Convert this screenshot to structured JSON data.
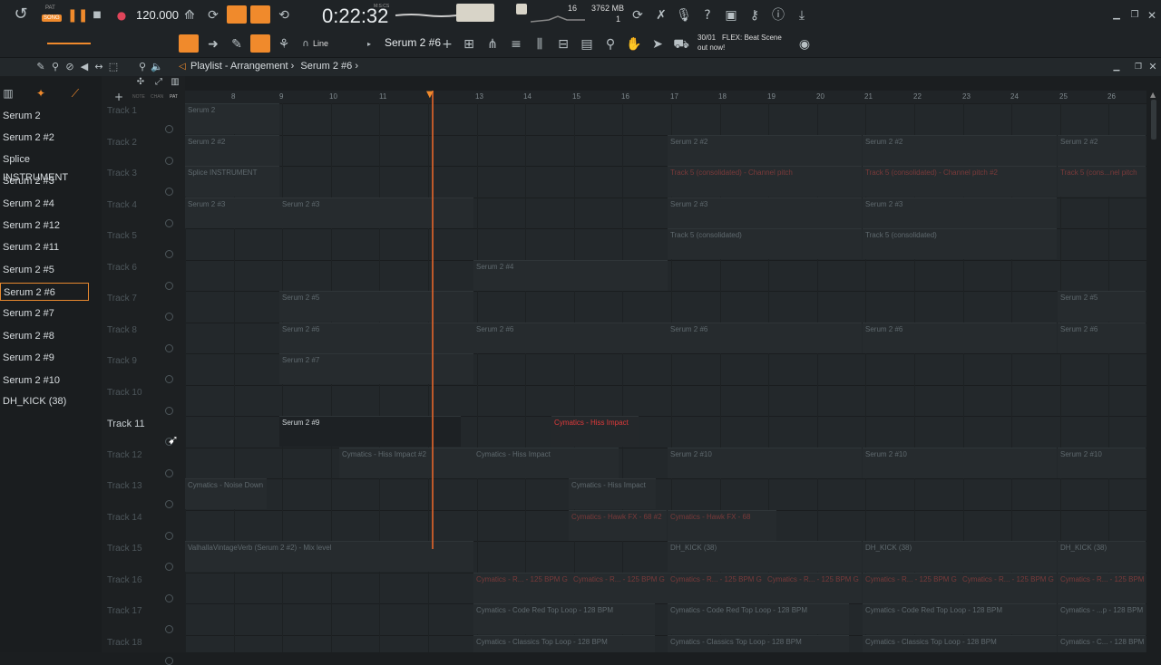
{
  "toolbar": {
    "song_label": "SONG",
    "tempo": "120.000",
    "time": "0:22:32",
    "time_sub": "M:S:CS",
    "cpu_number": "16",
    "memory": "3762 MB",
    "memory_sub": "1",
    "snap_mode": "Line",
    "pattern_name": "Serum 2 #6",
    "news_date": "30/01",
    "news_text_1": "FLEX: Beat Scene",
    "news_text_2": "out now!"
  },
  "playlist": {
    "breadcrumb_1": "Playlist",
    "breadcrumb_sep": " - ",
    "breadcrumb_2": "Arrangement",
    "breadcrumb_3": "Serum 2 #6",
    "header_labels": [
      "NOTE",
      "CHAN",
      "PAT"
    ]
  },
  "ruler": [
    "8",
    "9",
    "10",
    "11",
    "13",
    "14",
    "15",
    "16",
    "17",
    "18",
    "19",
    "20",
    "21",
    "22",
    "23",
    "24",
    "25",
    "26"
  ],
  "channels": [
    {
      "label": "Serum 2"
    },
    {
      "label": "Serum 2 #2"
    },
    {
      "label": "Splice INSTRUMENT"
    },
    {
      "label": "Serum 2 #3"
    },
    {
      "label": "Serum 2 #4"
    },
    {
      "label": "Serum 2 #12"
    },
    {
      "label": "Serum 2 #11"
    },
    {
      "label": "Serum 2 #5"
    },
    {
      "label": "Serum 2 #6"
    },
    {
      "label": "Serum 2 #7"
    },
    {
      "label": "Serum 2 #8"
    },
    {
      "label": "Serum 2 #9"
    },
    {
      "label": "Serum 2 #10"
    },
    {
      "label": "DH_KICK (38)"
    }
  ],
  "tracks": [
    "Track 1",
    "Track 2",
    "Track 3",
    "Track 4",
    "Track 5",
    "Track 6",
    "Track 7",
    "Track 8",
    "Track 9",
    "Track 10",
    "Track 11",
    "Track 12",
    "Track 13",
    "Track 14",
    "Track 15",
    "Track 16",
    "Track 17",
    "Track 18"
  ],
  "clips": {
    "c1": "Serum 2",
    "c2a": "Serum 2 #2",
    "c2b": "Serum 2 #2",
    "c2c": "Serum 2 #2",
    "c2d": "Serum 2 #2",
    "c3a": "Splice INSTRUMENT",
    "c3b": "Track 5 (consolidated) - Channel pitch",
    "c3c": "Track 5 (consolidated) - Channel pitch #2",
    "c3d": "Track 5 (cons...nel pitch",
    "c4a": "Serum 2 #3",
    "c4b": "Serum 2 #3",
    "c4c": "Serum 2 #3",
    "c4d": "Serum 2 #3",
    "c5a": "Track 5 (consolidated)",
    "c5b": "Track 5 (consolidated)",
    "c6a": "Serum 2 #4",
    "c7a": "Serum 2 #5",
    "c7b": "Serum 2 #5",
    "c8a": "Serum 2 #6",
    "c8b": "Serum 2 #6",
    "c8c": "Serum 2 #6",
    "c8d": "Serum 2 #6",
    "c8e": "Serum 2 #6",
    "c9a": "Serum 2 #7",
    "c11a": "Serum 2 #9",
    "c11b": "Cymatics - Hiss Impact",
    "c12a": "Cymatics - Hiss Impact #2",
    "c12b": "Cymatics - Hiss Impact",
    "c12c": "Serum 2 #10",
    "c12d": "Serum 2 #10",
    "c12e": "Serum 2 #10",
    "c13a": "Cymatics - Noise Down",
    "c13b": "Cymatics - Hiss Impact",
    "c14a": "Cymatics - Hawk FX - 68 #2",
    "c14b": "Cymatics - Hawk FX - 68",
    "c15a": "ValhallaVintageVerb (Serum 2 #2) - Mix level",
    "c15b": "DH_KICK (38)",
    "c15c": "DH_KICK (38)",
    "c15d": "DH_KICK (38)",
    "c16a": "Cymatics - R... - 125 BPM G",
    "c16b": "Cymatics - R... - 125 BPM G",
    "c16c": "Cymatics - R... - 125 BPM G",
    "c16d": "Cymatics - R... - 125 BPM G",
    "c16e": "Cymatics - R... - 125 BPM G",
    "c16f": "Cymatics - R... - 125 BPM G",
    "c16g": "Cymatics - R... - 125 BPM G",
    "c17a": "Cymatics - Code Red Top Loop - 128 BPM",
    "c17b": "Cymatics - Code Red Top Loop - 128 BPM",
    "c17c": "Cymatics - Code Red Top Loop - 128 BPM",
    "c17d": "Cymatics - ...p - 128 BPM",
    "c18a": "Cymatics - Classics Top Loop - 128 BPM",
    "c18b": "Cymatics - Classics Top Loop - 128 BPM",
    "c18c": "Cymatics - Classics Top Loop - 128 BPM",
    "c18d": "Cymatics - C... - 128 BPM"
  },
  "colors": {
    "accent": "#f08a2c",
    "playhead": "#d9622a",
    "selection": "#e7882f"
  }
}
